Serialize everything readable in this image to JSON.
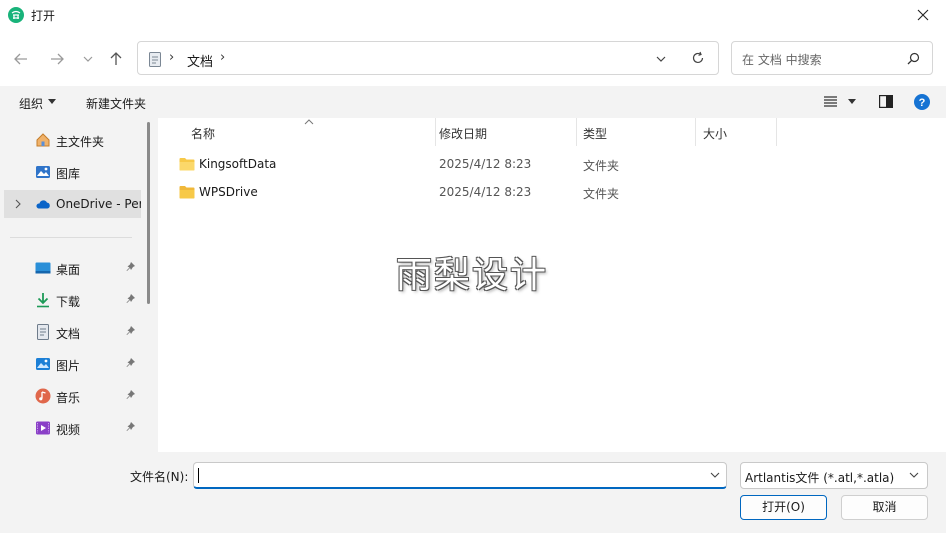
{
  "window": {
    "title": "打开",
    "accent": "#0067c0"
  },
  "address": {
    "crumb": "文档",
    "search_placeholder": "在 文档 中搜索"
  },
  "toolbar": {
    "organize": "组织",
    "new_folder": "新建文件夹"
  },
  "sidebar": {
    "items": [
      {
        "label": "主文件夹",
        "icon": "home-icon"
      },
      {
        "label": "图库",
        "icon": "gallery-icon"
      },
      {
        "label": "OneDrive - Per",
        "icon": "cloud-icon"
      },
      {
        "label": "桌面",
        "icon": "desktop-icon"
      },
      {
        "label": "下载",
        "icon": "download-icon"
      },
      {
        "label": "文档",
        "icon": "document-icon"
      },
      {
        "label": "图片",
        "icon": "picture-icon"
      },
      {
        "label": "音乐",
        "icon": "music-icon"
      },
      {
        "label": "视频",
        "icon": "video-icon"
      }
    ]
  },
  "columns": {
    "name": "名称",
    "modified": "修改日期",
    "type": "类型",
    "size": "大小"
  },
  "files": [
    {
      "name": "KingsoftData",
      "modified": "2025/4/12 8:23",
      "type": "文件夹"
    },
    {
      "name": "WPSDrive",
      "modified": "2025/4/12 8:23",
      "type": "文件夹"
    }
  ],
  "watermark": "雨梨设计",
  "footer": {
    "filename_label": "文件名(N):",
    "filename_value": "",
    "filetype": "Artlantis文件 (*.atl,*.atla)",
    "open": "打开(O)",
    "cancel": "取消"
  }
}
